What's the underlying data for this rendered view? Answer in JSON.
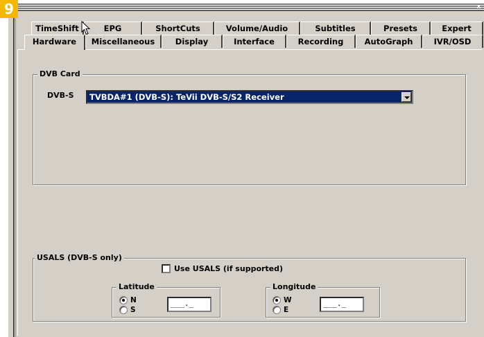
{
  "step_badge": "9",
  "window": {
    "close_glyph": "x"
  },
  "tabs": {
    "back_row": [
      {
        "label": "TimeShift"
      },
      {
        "label": "EPG"
      },
      {
        "label": "ShortCuts"
      },
      {
        "label": "Volume/Audio"
      },
      {
        "label": "Subtitles"
      },
      {
        "label": "Presets"
      },
      {
        "label": "Expert"
      }
    ],
    "front_row": [
      {
        "label": "Hardware",
        "active": true
      },
      {
        "label": "Miscellaneous"
      },
      {
        "label": "Display"
      },
      {
        "label": "Interface"
      },
      {
        "label": "Recording"
      },
      {
        "label": "AutoGraph"
      },
      {
        "label": "IVR/OSD"
      }
    ]
  },
  "dvb_card": {
    "title": "DVB Card",
    "dvbs_label": "DVB-S",
    "dvbs_value": "TVBDA#1 (DVB-S): TeVii DVB-S/S2 Receiver"
  },
  "usals": {
    "title": "USALS (DVB-S only)",
    "use_usals_label": "Use USALS (if supported)",
    "use_usals_checked": false,
    "latitude": {
      "title": "Latitude",
      "options": [
        {
          "label": "N",
          "checked": true
        },
        {
          "label": "S",
          "checked": false
        }
      ],
      "value": "___._"
    },
    "longitude": {
      "title": "Longitude",
      "options": [
        {
          "label": "W",
          "checked": true
        },
        {
          "label": "E",
          "checked": false
        }
      ],
      "value": "___._"
    }
  },
  "icons": {
    "cursor": "mouse-pointer-icon",
    "dropdown": "chevron-down-icon",
    "close": "close-icon"
  }
}
